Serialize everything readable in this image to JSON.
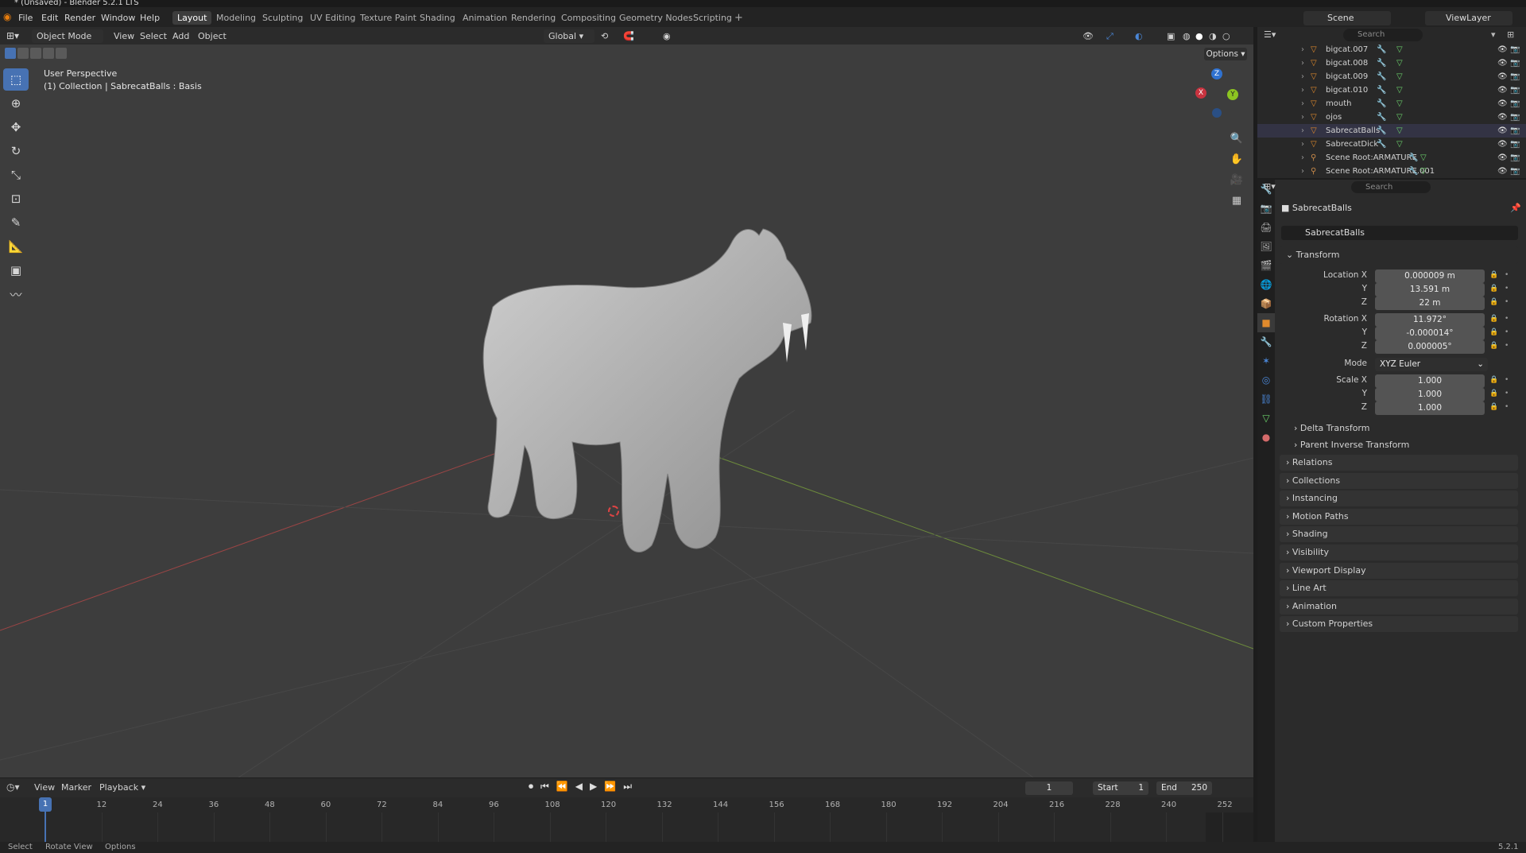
{
  "window": {
    "title": "* (Unsaved) - Blender 5.2.1 LTS"
  },
  "menubar": {
    "items": [
      "File",
      "Edit",
      "Render",
      "Window",
      "Help"
    ]
  },
  "workspaces": [
    {
      "label": "Layout",
      "active": true
    },
    {
      "label": "Modeling"
    },
    {
      "label": "Sculpting"
    },
    {
      "label": "UV Editing"
    },
    {
      "label": "Texture Paint"
    },
    {
      "label": "Shading"
    },
    {
      "label": "Animation"
    },
    {
      "label": "Rendering"
    },
    {
      "label": "Compositing"
    },
    {
      "label": "Geometry Nodes"
    },
    {
      "label": "Scripting"
    }
  ],
  "scene": {
    "label": "Scene",
    "viewlayer": "ViewLayer"
  },
  "viewport_header": {
    "mode": "Object Mode",
    "menus": [
      "View",
      "Select",
      "Add",
      "Object"
    ],
    "orientation": "Global",
    "options": "Options"
  },
  "viewport": {
    "perspective": "User Perspective",
    "collection_info": "(1) Collection | SabrecatBalls : Basis",
    "gizmo": {
      "x": "X",
      "y": "Y",
      "z": "Z"
    }
  },
  "outliner": {
    "search_placeholder": "Search",
    "rows": [
      {
        "name": "bigcat.007",
        "icon": "mesh-icon"
      },
      {
        "name": "bigcat.008",
        "icon": "mesh-icon"
      },
      {
        "name": "bigcat.009",
        "icon": "mesh-icon"
      },
      {
        "name": "bigcat.010",
        "icon": "mesh-icon"
      },
      {
        "name": "mouth",
        "icon": "mesh-icon"
      },
      {
        "name": "ojos",
        "icon": "mesh-icon"
      },
      {
        "name": "SabrecatBalls",
        "icon": "mesh-icon"
      },
      {
        "name": "SabrecatDick",
        "icon": "mesh-icon"
      },
      {
        "name": "Scene Root:ARMATURE",
        "icon": "armature-icon"
      },
      {
        "name": "Scene Root:ARMATURE.001",
        "icon": "armature-icon"
      }
    ]
  },
  "properties": {
    "search_placeholder": "Search",
    "object_name": "SabrecatBalls",
    "object_field": "SabrecatBalls",
    "transform": {
      "title": "Transform",
      "location_label": "Location X",
      "loc_x": "0.000009 m",
      "loc_y": "13.591 m",
      "loc_z": "22 m",
      "rotation_label": "Rotation X",
      "rot_x": "11.972°",
      "rot_y": "-0.000014°",
      "rot_z": "0.000005°",
      "mode_label": "Mode",
      "mode": "XYZ Euler",
      "scale_label": "Scale X",
      "scale_x": "1.000",
      "scale_y": "1.000",
      "scale_z": "1.000",
      "y": "Y",
      "z": "Z"
    },
    "subpanels": [
      "Delta Transform",
      "Parent Inverse Transform"
    ],
    "panels": [
      "Relations",
      "Collections",
      "Instancing",
      "Motion Paths",
      "Shading",
      "Visibility",
      "Viewport Display",
      "Line Art",
      "Animation",
      "Custom Properties"
    ]
  },
  "timeline": {
    "menus": [
      "View",
      "Marker",
      "Playback"
    ],
    "current_frame": "1",
    "start_label": "Start",
    "start": "1",
    "end_label": "End",
    "end": "250",
    "ticks": [
      "1",
      "12",
      "24",
      "36",
      "48",
      "60",
      "72",
      "84",
      "96",
      "108",
      "120",
      "132",
      "144",
      "156",
      "168",
      "180",
      "192",
      "204",
      "216",
      "228",
      "240",
      "252"
    ]
  },
  "statusbar": {
    "select": "Select",
    "rotate": "Rotate View",
    "options": "Options",
    "version": "5.2.1"
  },
  "colors": {
    "accent": "#4772b3",
    "x_axis": "#c8333f",
    "y_axis": "#8cc521",
    "z_axis": "#2f72d1"
  }
}
